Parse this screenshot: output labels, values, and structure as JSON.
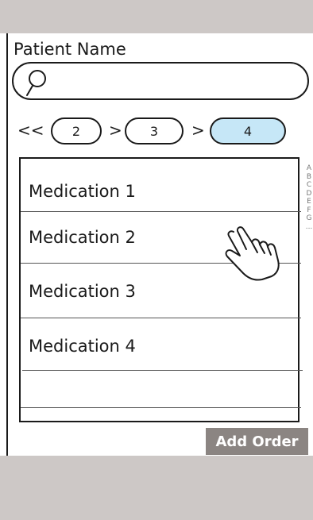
{
  "form": {
    "field_label": "Patient Name",
    "search_placeholder": ""
  },
  "pager": {
    "first": "<<",
    "separator": ">",
    "pages": [
      "2",
      "3",
      "4"
    ],
    "active_page": "4"
  },
  "medications": {
    "items": [
      "Medication 1",
      "Medication 2",
      "Medication 3",
      "Medication 4",
      ""
    ]
  },
  "index_bar": {
    "letters": [
      "A",
      "B",
      "C",
      "D",
      "E",
      "F",
      "G",
      "..."
    ]
  },
  "actions": {
    "add_order": "Add Order"
  },
  "colors": {
    "bars": "#cdc8c6",
    "active_page": "#c6e7f7",
    "button": "#8b8582"
  },
  "icons": {
    "search": "magnifier-icon",
    "cursor": "hand-pointer-icon"
  }
}
